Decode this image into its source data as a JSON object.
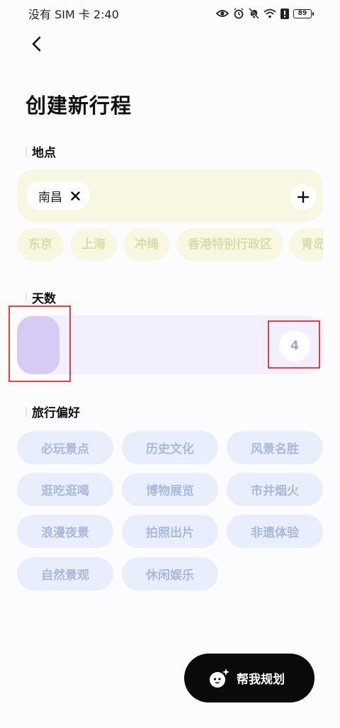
{
  "status_bar": {
    "carrier_time": "没有 SIM 卡 2:40",
    "battery": "89"
  },
  "page": {
    "title": "创建新行程"
  },
  "location": {
    "label": "地点",
    "selected": "南昌",
    "suggestions": [
      "东京",
      "上海",
      "冲绳",
      "香港特别行政区",
      "青岛"
    ]
  },
  "days": {
    "label": "天数",
    "value": "4"
  },
  "preferences": {
    "label": "旅行偏好",
    "options": [
      "必玩景点",
      "历史文化",
      "风景名胜",
      "逛吃逛喝",
      "博物展览",
      "市井烟火",
      "浪漫夜景",
      "拍照出片",
      "非遗体验",
      "自然景观",
      "休闲娱乐"
    ]
  },
  "actions": {
    "plan_label": "帮我规划"
  },
  "colors": {
    "location_bg": "#F8F8E2",
    "days_bg": "#F4EFFE",
    "days_thumb": "#D7CBF6",
    "pref_bg": "#E8EEFB",
    "highlight": "#D6424A"
  }
}
